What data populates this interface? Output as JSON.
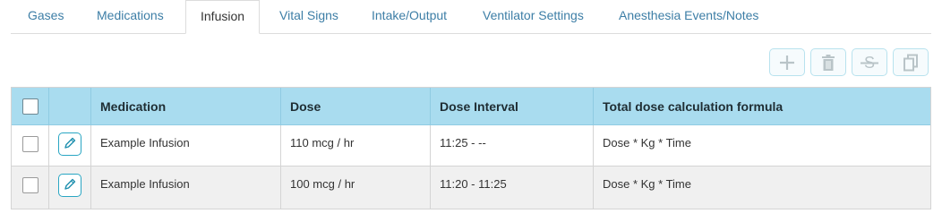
{
  "tabs": [
    {
      "label": "Gases"
    },
    {
      "label": "Medications"
    },
    {
      "label": "Infusion"
    },
    {
      "label": "Vital Signs"
    },
    {
      "label": "Intake/Output"
    },
    {
      "label": "Ventilator Settings"
    },
    {
      "label": "Anesthesia Events/Notes"
    }
  ],
  "active_tab": "Infusion",
  "toolbar": {
    "buttons": [
      {
        "icon": "plus-icon",
        "enabled": false
      },
      {
        "icon": "trash-icon",
        "enabled": false
      },
      {
        "icon": "strikethrough-icon",
        "enabled": false
      },
      {
        "icon": "copy-icon",
        "enabled": false
      }
    ]
  },
  "table": {
    "columns": [
      "",
      "",
      "Medication",
      "Dose",
      "Dose Interval",
      "Total dose calculation formula"
    ],
    "rows": [
      {
        "medication": "Example Infusion",
        "dose": "110 mcg / hr",
        "interval": "11:25 - --",
        "formula": "Dose * Kg * Time"
      },
      {
        "medication": "Example Infusion",
        "dose": "100 mcg / hr",
        "interval": "11:20 - 11:25",
        "formula": "Dose * Kg * Time"
      }
    ]
  },
  "colors": {
    "header_bg": "#a9dcef",
    "tab_link": "#3d7ea6",
    "accent": "#2aa6c3",
    "alt_row": "#f0f0f0"
  }
}
